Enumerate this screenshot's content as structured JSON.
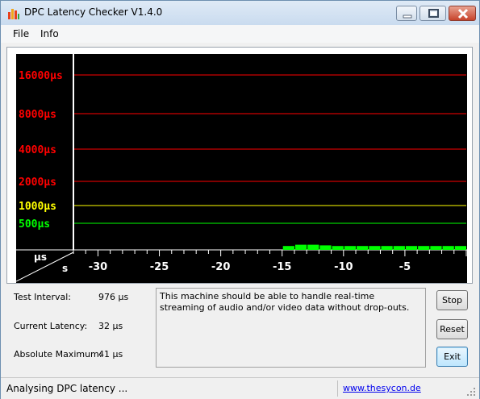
{
  "window": {
    "title": "DPC Latency Checker V1.4.0",
    "controls": [
      "minimize-icon",
      "maximize-icon",
      "close-icon"
    ]
  },
  "menu": {
    "items": [
      "File",
      "Info"
    ]
  },
  "graph": {
    "background": "#000000",
    "axis_corner": {
      "unit_y": "µs",
      "unit_x": "s"
    },
    "latency_lines": [
      {
        "label": "16000µs",
        "value_us": 16000,
        "color": "#ff0000"
      },
      {
        "label": "8000µs",
        "value_us": 8000,
        "color": "#ff0000"
      },
      {
        "label": "4000µs",
        "value_us": 4000,
        "color": "#ff0000"
      },
      {
        "label": "2000µs",
        "value_us": 2000,
        "color": "#ff0000"
      },
      {
        "label": "1000µs",
        "value_us": 1000,
        "color": "#ffff00"
      },
      {
        "label": "500µs",
        "value_us": 500,
        "color": "#00ff00"
      }
    ],
    "time_ticks": [
      "-30",
      "-25",
      "-20",
      "-15",
      "-10",
      "-5"
    ],
    "time_tick_values": [
      -30,
      -25,
      -20,
      -15,
      -10,
      -5
    ],
    "time_range_s": [
      -32,
      0
    ],
    "bar_color": "#00ff00",
    "bars": [
      {
        "t_s": -14.5,
        "level": 0.6
      },
      {
        "t_s": -13.5,
        "level": 0.8
      },
      {
        "t_s": -12.5,
        "level": 0.8
      },
      {
        "t_s": -11.5,
        "level": 0.7
      },
      {
        "t_s": -10.5,
        "level": 0.6
      },
      {
        "t_s": -9.5,
        "level": 0.6
      },
      {
        "t_s": -8.5,
        "level": 0.6
      },
      {
        "t_s": -7.5,
        "level": 0.6
      },
      {
        "t_s": -6.5,
        "level": 0.6
      },
      {
        "t_s": -5.5,
        "level": 0.6
      },
      {
        "t_s": -4.5,
        "level": 0.6
      },
      {
        "t_s": -3.5,
        "level": 0.6
      },
      {
        "t_s": -2.5,
        "level": 0.6
      },
      {
        "t_s": -1.5,
        "level": 0.6
      },
      {
        "t_s": -0.5,
        "level": 0.6
      }
    ]
  },
  "info": {
    "test_interval_label": "Test Interval:",
    "test_interval_value": "976 µs",
    "current_latency_label": "Current Latency:",
    "current_latency_value": "32 µs",
    "absolute_maximum_label": "Absolute Maximum:",
    "absolute_maximum_value": "41 µs"
  },
  "message": "This machine should be able to handle real-time streaming of audio and/or video data without drop-outs.",
  "buttons": {
    "stop": "Stop",
    "reset": "Reset",
    "exit": "Exit"
  },
  "status": {
    "text": "Analysing DPC latency ...",
    "link": "www.thesycon.de"
  }
}
